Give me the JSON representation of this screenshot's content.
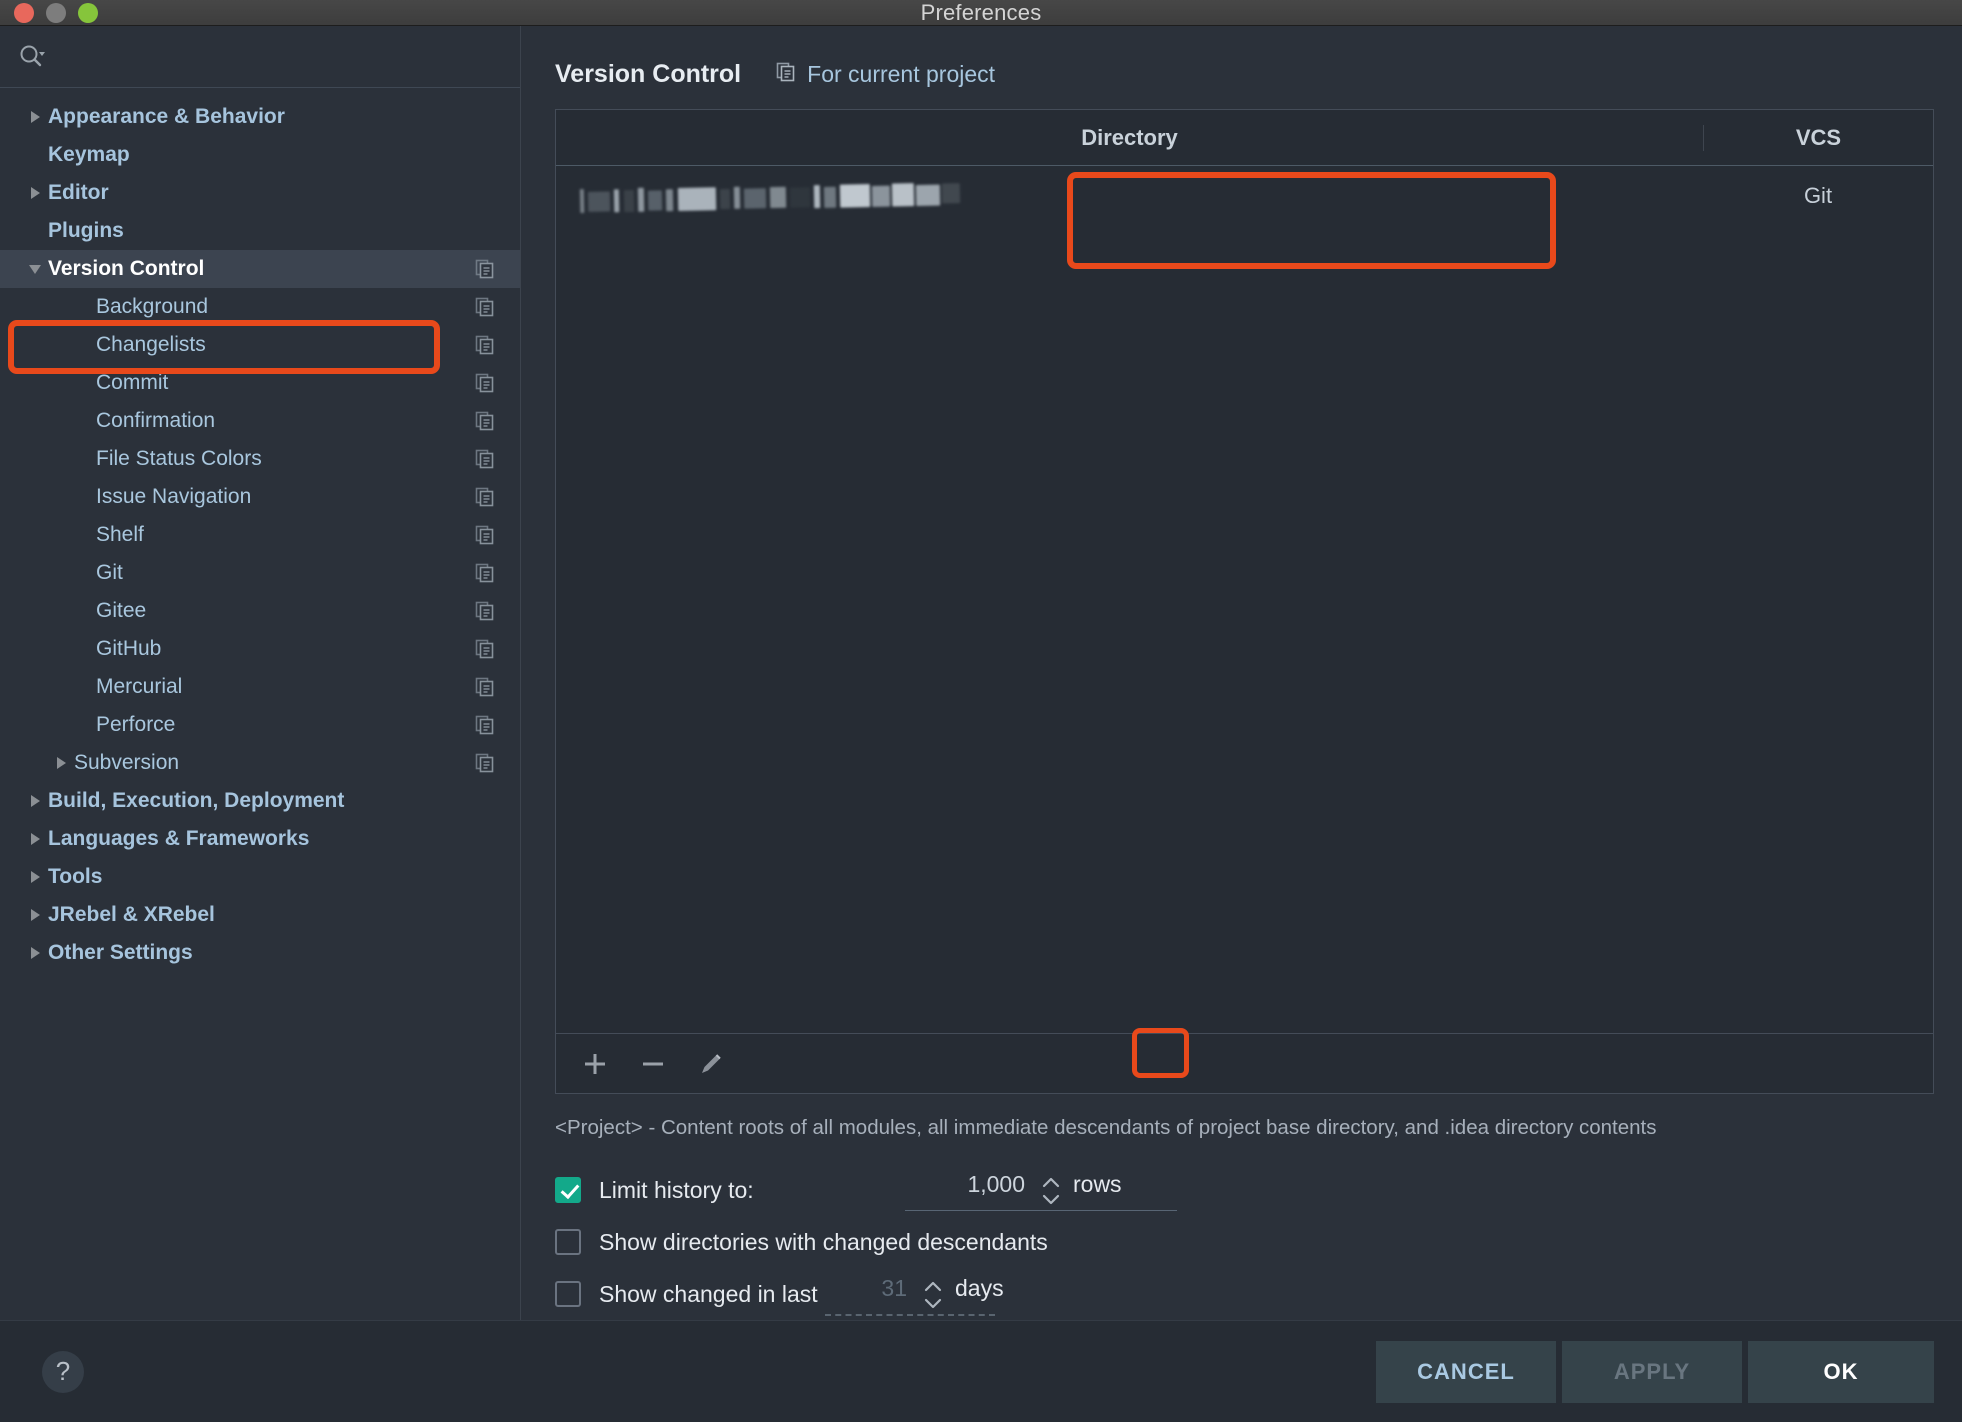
{
  "window": {
    "title": "Preferences",
    "traffic_lights": [
      "close-button",
      "minimize-button",
      "maximize-button"
    ]
  },
  "sidebar": {
    "search": {
      "value": "",
      "placeholder": "",
      "icon": "search-icon"
    },
    "items": [
      {
        "label": "Appearance & Behavior",
        "level": 0,
        "twisty": "collapsed",
        "bold": true,
        "copy_icon": false,
        "selected": false
      },
      {
        "label": "Keymap",
        "level": 0,
        "twisty": "none",
        "bold": true,
        "copy_icon": false,
        "selected": false
      },
      {
        "label": "Editor",
        "level": 0,
        "twisty": "collapsed",
        "bold": true,
        "copy_icon": false,
        "selected": false
      },
      {
        "label": "Plugins",
        "level": 0,
        "twisty": "none",
        "bold": true,
        "copy_icon": false,
        "selected": false
      },
      {
        "label": "Version Control",
        "level": 0,
        "twisty": "expanded",
        "bold": true,
        "copy_icon": true,
        "selected": true
      },
      {
        "label": "Background",
        "level": 1,
        "twisty": "none",
        "bold": false,
        "copy_icon": true,
        "selected": false
      },
      {
        "label": "Changelists",
        "level": 1,
        "twisty": "none",
        "bold": false,
        "copy_icon": true,
        "selected": false
      },
      {
        "label": "Commit",
        "level": 1,
        "twisty": "none",
        "bold": false,
        "copy_icon": true,
        "selected": false
      },
      {
        "label": "Confirmation",
        "level": 1,
        "twisty": "none",
        "bold": false,
        "copy_icon": true,
        "selected": false
      },
      {
        "label": "File Status Colors",
        "level": 1,
        "twisty": "none",
        "bold": false,
        "copy_icon": true,
        "selected": false
      },
      {
        "label": "Issue Navigation",
        "level": 1,
        "twisty": "none",
        "bold": false,
        "copy_icon": true,
        "selected": false
      },
      {
        "label": "Shelf",
        "level": 1,
        "twisty": "none",
        "bold": false,
        "copy_icon": true,
        "selected": false
      },
      {
        "label": "Git",
        "level": 1,
        "twisty": "none",
        "bold": false,
        "copy_icon": true,
        "selected": false
      },
      {
        "label": "Gitee",
        "level": 1,
        "twisty": "none",
        "bold": false,
        "copy_icon": true,
        "selected": false
      },
      {
        "label": "GitHub",
        "level": 1,
        "twisty": "none",
        "bold": false,
        "copy_icon": true,
        "selected": false
      },
      {
        "label": "Mercurial",
        "level": 1,
        "twisty": "none",
        "bold": false,
        "copy_icon": true,
        "selected": false
      },
      {
        "label": "Perforce",
        "level": 1,
        "twisty": "none",
        "bold": false,
        "copy_icon": true,
        "selected": false
      },
      {
        "label": "Subversion",
        "level": 1,
        "twisty": "collapsed",
        "bold": false,
        "copy_icon": true,
        "selected": false
      },
      {
        "label": "Build, Execution, Deployment",
        "level": 0,
        "twisty": "collapsed",
        "bold": true,
        "copy_icon": false,
        "selected": false
      },
      {
        "label": "Languages & Frameworks",
        "level": 0,
        "twisty": "collapsed",
        "bold": true,
        "copy_icon": false,
        "selected": false
      },
      {
        "label": "Tools",
        "level": 0,
        "twisty": "collapsed",
        "bold": true,
        "copy_icon": false,
        "selected": false
      },
      {
        "label": "JRebel & XRebel",
        "level": 0,
        "twisty": "collapsed",
        "bold": true,
        "copy_icon": false,
        "selected": false
      },
      {
        "label": "Other Settings",
        "level": 0,
        "twisty": "collapsed",
        "bold": true,
        "copy_icon": false,
        "selected": false
      }
    ]
  },
  "main": {
    "title": "Version Control",
    "scope_link": {
      "label": "For current project",
      "icon": "copy-to-project-icon"
    },
    "table": {
      "columns": [
        "Directory",
        "VCS"
      ],
      "rows": [
        {
          "directory": "",
          "directory_redacted": true,
          "vcs": "Git"
        }
      ]
    },
    "toolbar": [
      {
        "name": "add-directory-button",
        "glyph": "+",
        "icon": "plus-icon"
      },
      {
        "name": "remove-directory-button",
        "glyph": "–",
        "icon": "minus-icon"
      },
      {
        "name": "edit-directory-button",
        "glyph": "",
        "icon": "pencil-icon"
      }
    ],
    "hint": "<Project> - Content roots of all modules, all immediate descendants of project base directory, and .idea directory contents",
    "options": [
      {
        "name": "limit-history",
        "label": "Limit history to:",
        "checked": true,
        "value": "1,000",
        "unit": "rows",
        "value_dim": false,
        "underline": "solid"
      },
      {
        "name": "show-changed-dirs",
        "label": "Show directories with changed descendants",
        "checked": false,
        "value": "",
        "unit": "",
        "value_dim": false,
        "underline": "none"
      },
      {
        "name": "show-changed-in-last",
        "label": "Show changed in last",
        "checked": false,
        "value": "31",
        "unit": "days",
        "value_dim": true,
        "underline": "dotted"
      }
    ]
  },
  "footer": {
    "help_label": "?",
    "buttons": [
      {
        "name": "cancel-button",
        "label": "CANCEL",
        "state": "enabled"
      },
      {
        "name": "apply-button",
        "label": "APPLY",
        "state": "disabled"
      },
      {
        "name": "ok-button",
        "label": "OK",
        "state": "primary"
      }
    ]
  },
  "annotations": {
    "color": "#e8491b",
    "boxes": [
      "sidebar-version-control-highlight",
      "directory-row-highlight",
      "remove-button-highlight"
    ]
  }
}
